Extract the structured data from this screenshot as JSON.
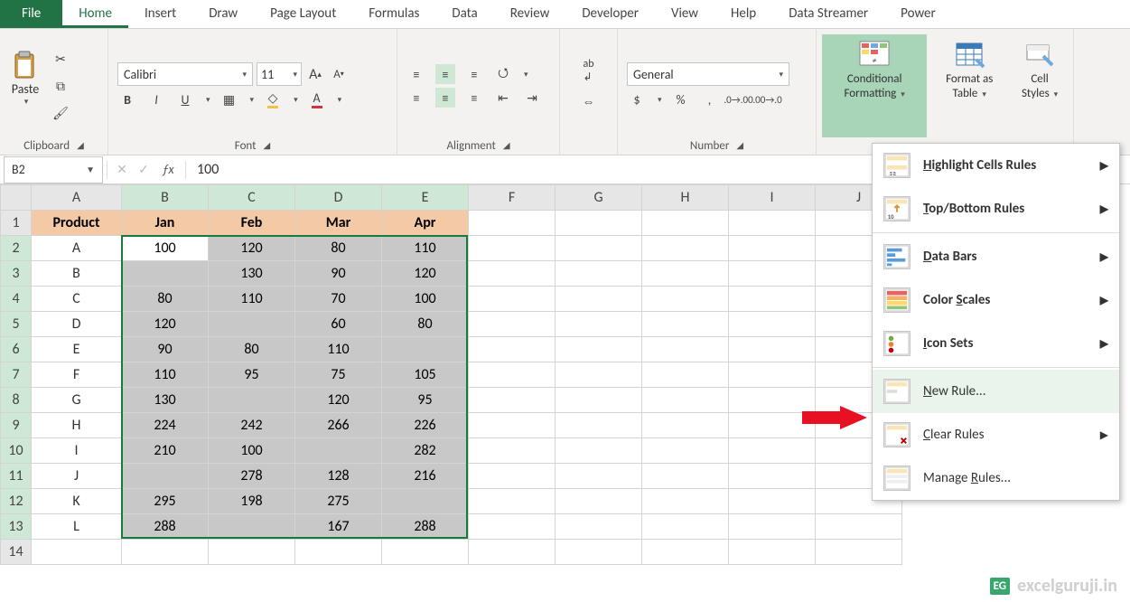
{
  "tabs": [
    "File",
    "Home",
    "Insert",
    "Draw",
    "Page Layout",
    "Formulas",
    "Data",
    "Review",
    "Developer",
    "View",
    "Help",
    "Data Streamer",
    "Power"
  ],
  "active_tab": "Home",
  "ribbon": {
    "clipboard": {
      "label": "Clipboard",
      "paste": "Paste"
    },
    "font": {
      "label": "Font",
      "name": "Calibri",
      "size": "11",
      "bold": "B",
      "italic": "I",
      "underline": "U"
    },
    "alignment": {
      "label": "Alignment"
    },
    "number": {
      "label": "Number",
      "format": "General"
    },
    "styles": {
      "cf": "Conditional Formatting",
      "fat": "Format as Table",
      "cell": "Cell Styles"
    }
  },
  "cf_menu": {
    "highlight": "Highlight Cells Rules",
    "topbottom": "Top/Bottom Rules",
    "databars": "Data Bars",
    "colorscales": "Color Scales",
    "iconsets": "Icon Sets",
    "newrule": "New Rule...",
    "clear": "Clear Rules",
    "manage": "Manage Rules..."
  },
  "cf_accel": {
    "h": "H",
    "t": "T",
    "d": "D",
    "s": "S",
    "i": "I",
    "n": "N",
    "c": "C",
    "r": "R"
  },
  "formula_bar": {
    "ref": "B2",
    "value": "100"
  },
  "columns": [
    "A",
    "B",
    "C",
    "D",
    "E",
    "F",
    "G",
    "H",
    "I",
    "J"
  ],
  "headers": [
    "Product",
    "Jan",
    "Feb",
    "Mar",
    "Apr"
  ],
  "rows": [
    {
      "p": "A",
      "v": [
        "100",
        "120",
        "80",
        "110"
      ]
    },
    {
      "p": "B",
      "v": [
        "",
        "130",
        "90",
        "120"
      ]
    },
    {
      "p": "C",
      "v": [
        "80",
        "110",
        "70",
        "100"
      ]
    },
    {
      "p": "D",
      "v": [
        "120",
        "",
        "60",
        "80"
      ]
    },
    {
      "p": "E",
      "v": [
        "90",
        "80",
        "110",
        ""
      ]
    },
    {
      "p": "F",
      "v": [
        "110",
        "95",
        "75",
        "105"
      ]
    },
    {
      "p": "G",
      "v": [
        "130",
        "",
        "120",
        "95"
      ]
    },
    {
      "p": "H",
      "v": [
        "224",
        "242",
        "266",
        "226"
      ]
    },
    {
      "p": "I",
      "v": [
        "210",
        "100",
        "",
        "282"
      ]
    },
    {
      "p": "J",
      "v": [
        "",
        "278",
        "128",
        "216"
      ]
    },
    {
      "p": "K",
      "v": [
        "295",
        "198",
        "275",
        ""
      ]
    },
    {
      "p": "L",
      "v": [
        "288",
        "",
        "167",
        "288"
      ]
    }
  ],
  "col_widths": {
    "rowhdr": 34,
    "A": 100,
    "B": 96,
    "C": 96,
    "D": 96,
    "E": 96,
    "rest": 96
  },
  "watermark": "excelguruji.in",
  "watermark_badge": "EG"
}
